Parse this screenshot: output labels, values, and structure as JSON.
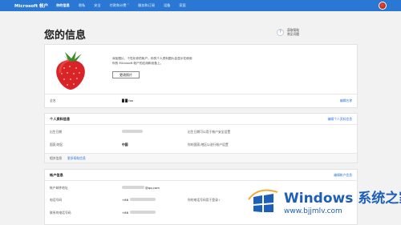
{
  "topbar": {
    "brand": "Microsoft 帐户",
    "nav": [
      "你的信息",
      "隐私",
      "安全",
      "付款和计费 ˅",
      "服务和订阅",
      "设备",
      "家庭"
    ]
  },
  "page": {
    "title": "您的信息"
  },
  "help": {
    "line1": "获取帮助",
    "line2": "常见问题"
  },
  "profile": {
    "description_line1": "添加图片，个性化你的帐户。你的个人资料图片会显示在使用",
    "description_line2": "你的 Microsoft 帐户的应用和设备上。",
    "change_photo": "更改照片",
    "name_label": "全名",
    "name_value": "█ █ fox",
    "edit_name": "编辑名称"
  },
  "personal": {
    "title": "个人资料信息",
    "edit_link": "编辑个人资料信息",
    "birthday_label": "出生日期",
    "birthday_note": "出生日期可以用于帐户安全设置",
    "region_label": "国家/地区",
    "region_value": "中国",
    "region_note": "你的国家/地区以进行帐户设置",
    "language_label": "相关信息",
    "language_link": "更多帮助信息"
  },
  "account": {
    "title": "帐户信息",
    "edit_link": "编辑帐户信息",
    "email_label": "帐户邮件地址",
    "email_value": "@qq.com",
    "phone_label": "电话号码",
    "phone_prefix": "+86",
    "phone_note": "你的电话号码用于登录 i",
    "alt_label": "联系的电话号码",
    "alt_prefix": "+86"
  },
  "watermark": {
    "title": "Windows 系统之家",
    "url": "www.bjjmlv.com"
  },
  "colors": {
    "accent": "#2b78d4",
    "watermark": "#1d5eb8"
  }
}
